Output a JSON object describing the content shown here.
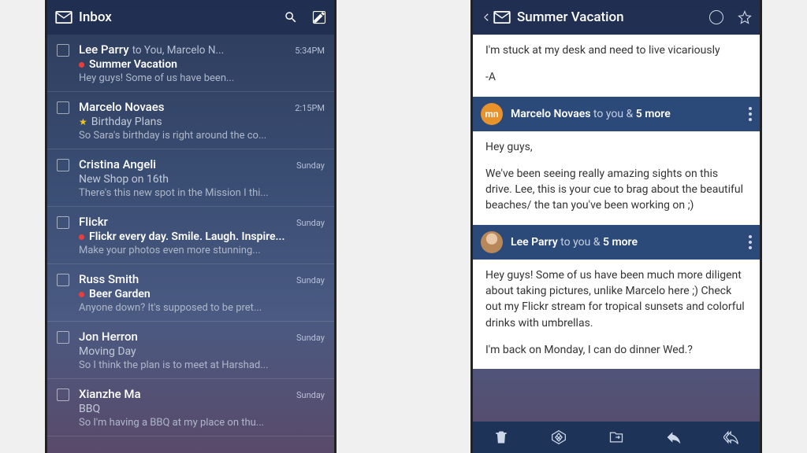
{
  "inbox": {
    "title": "Inbox",
    "rows": [
      {
        "sender": "Lee Parry",
        "recip": "to You, Marcelo N...",
        "time": "5:34PM",
        "marker": "red",
        "subject": "Summer Vacation",
        "bold": true,
        "preview": "Hey guys!  Some of us have been..."
      },
      {
        "sender": "Marcelo Novaes",
        "recip": "",
        "time": "2:15PM",
        "marker": "star",
        "subject": "Birthday Plans",
        "bold": false,
        "preview": "So Sara's birthday is right around the co..."
      },
      {
        "sender": "Cristina Angeli",
        "recip": "",
        "time": "Sunday",
        "marker": "",
        "subject": "New Shop on 16th",
        "bold": false,
        "preview": "There's this new spot in the Mission I thi..."
      },
      {
        "sender": "Flickr",
        "recip": "",
        "time": "Sunday",
        "marker": "red",
        "subject": "Flickr every day. Smile. Laugh. Inspire...",
        "bold": true,
        "preview": "Make your photos even more stunning..."
      },
      {
        "sender": "Russ Smith",
        "recip": "",
        "time": "Sunday",
        "marker": "red",
        "subject": "Beer Garden",
        "bold": true,
        "preview": "Anyone down? It's supposed to be pret..."
      },
      {
        "sender": "Jon Herron",
        "recip": "",
        "time": "Sunday",
        "marker": "",
        "subject": "Moving Day",
        "bold": false,
        "preview": "So I think the plan is to meet at Harshad..."
      },
      {
        "sender": "Xianzhe Ma",
        "recip": "",
        "time": "Sunday",
        "marker": "",
        "subject": "BBQ",
        "bold": false,
        "preview": "So I'm having a BBQ at my place on thu..."
      }
    ]
  },
  "thread": {
    "title": "Summer Vacation",
    "intro_body": "I'm stuck at my desk and need to live vicariously",
    "intro_sig": "-A",
    "msgs": [
      {
        "avatar": "mn",
        "avatar_kind": "orange",
        "name": "Marcelo Novaes",
        "rest": " to you & ",
        "more": "5 more",
        "body": "Hey guys,\n\nWe've been seeing really amazing sights on this drive. Lee, this is your cue to brag about the beautiful beaches/ the tan you've been working on ;)"
      },
      {
        "avatar": "",
        "avatar_kind": "img",
        "name": "Lee Parry",
        "rest": " to you & ",
        "more": "5 more",
        "body": "Hey guys! Some of us have been much more diligent about taking pictures, unlike Marcelo here ;) Check out my Flickr stream for tropical sunsets and colorful drinks with umbrellas.\n\nI'm back on Monday, I can do dinner Wed.?"
      }
    ]
  }
}
